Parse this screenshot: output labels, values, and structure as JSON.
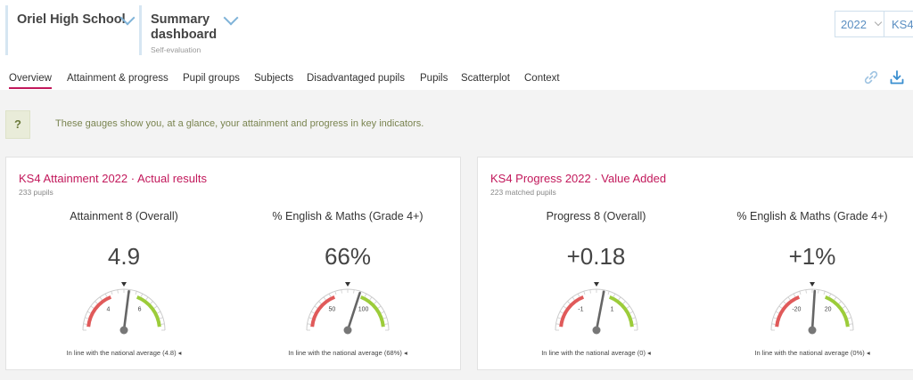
{
  "header": {
    "school": {
      "name": "Oriel High School"
    },
    "dashboard": {
      "line1": "Summary",
      "line2": "dashboard",
      "subtitle": "Self-evaluation"
    },
    "year": "2022",
    "key_stage": "KS4"
  },
  "tabs": [
    {
      "label": "Overview",
      "active": true
    },
    {
      "label": "Attainment & progress"
    },
    {
      "label": "Pupil groups"
    },
    {
      "label": "Subjects"
    },
    {
      "label": "Disadvantaged pupils"
    },
    {
      "label": "Pupils"
    },
    {
      "label": "Scatterplot"
    },
    {
      "label": "Context"
    }
  ],
  "info": {
    "icon_text": "?",
    "text": "These gauges show you, at a glance, your attainment and progress in key indicators."
  },
  "cards": [
    {
      "title": "KS4 Attainment 2022 · Actual results",
      "subtitle": "233 pupils",
      "metrics": [
        {
          "title": "Attainment 8 (Overall)",
          "value": "4.9",
          "low_label": "4",
          "high_label": "6",
          "needle_fraction": 0.54,
          "footer": "In line with the national average (4.8) ◂"
        },
        {
          "title": "% English & Maths (Grade 4+)",
          "value": "66%",
          "low_label": "50",
          "high_label": "100",
          "needle_fraction": 0.6,
          "footer": "In line with the national average (68%) ◂"
        }
      ]
    },
    {
      "title": "KS4 Progress 2022 · Value Added",
      "subtitle": "223 matched pupils",
      "metrics": [
        {
          "title": "Progress 8 (Overall)",
          "value": "+0.18",
          "low_label": "-1",
          "high_label": "1",
          "needle_fraction": 0.56,
          "footer": "In line with the national average (0) ◂"
        },
        {
          "title": "% English & Maths (Grade 4+)",
          "value": "+1%",
          "low_label": "-20",
          "high_label": "20",
          "needle_fraction": 0.52,
          "footer": "In line with the national average (0%) ◂"
        }
      ]
    }
  ],
  "colors": {
    "accent": "#c2185b",
    "gauge_low": "#e05a5a",
    "gauge_high": "#9ccc3a",
    "gauge_track": "#cccccc",
    "needle": "#666666"
  },
  "icons": {
    "link": "link-icon",
    "download": "download-icon",
    "help": "help-icon"
  }
}
